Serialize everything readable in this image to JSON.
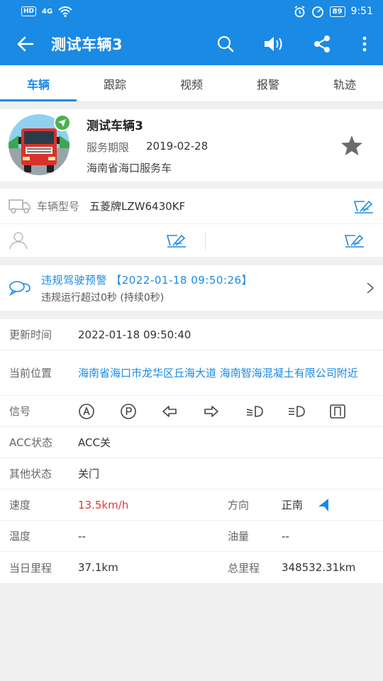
{
  "status_bar": {
    "hd": "HD",
    "net": "4G",
    "time": "9:51",
    "battery": "89"
  },
  "appbar": {
    "title": "测试车辆3"
  },
  "tabs": [
    {
      "label": "车辆",
      "active": true
    },
    {
      "label": "跟踪"
    },
    {
      "label": "视频"
    },
    {
      "label": "报警"
    },
    {
      "label": "轨迹"
    }
  ],
  "vehicle": {
    "name": "测试车辆3",
    "service_label": "服务期限",
    "service_date": "2019-02-28",
    "desc": "海南省海口服务车"
  },
  "model": {
    "label": "车辆型号",
    "value": "五菱牌LZW6430KF"
  },
  "alarm": {
    "line1": "违规驾驶预警 【2022-01-18 09:50:26】",
    "line2": "违规运行超过0秒 (持续0秒)"
  },
  "details": {
    "update_label": "更新时间",
    "update_value": "2022-01-18 09:50:40",
    "location_label": "当前位置",
    "location_value": "海南省海口市龙华区丘海大道 海南智海混凝土有限公司附近",
    "signal_label": "信号",
    "acc_label": "ACC状态",
    "acc_value": "ACC关",
    "other_label": "其他状态",
    "other_value": "关门",
    "speed_label": "速度",
    "speed_value": "13.5km/h",
    "direction_label": "方向",
    "direction_value": "正南",
    "temp_label": "温度",
    "temp_value": "--",
    "fuel_label": "油量",
    "fuel_value": "--",
    "day_mileage_label": "当日里程",
    "day_mileage_value": "37.1km",
    "total_mileage_label": "总里程",
    "total_mileage_value": "348532.31km"
  },
  "colors": {
    "primary": "#1a8ae5",
    "speed": "#e53935",
    "online": "#4caf50"
  }
}
